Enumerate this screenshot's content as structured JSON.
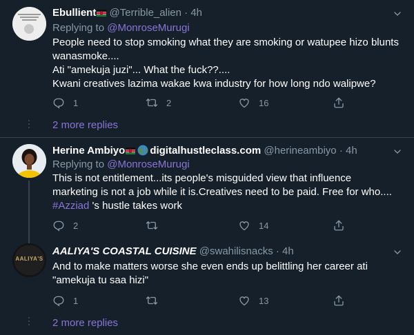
{
  "colors": {
    "background": "#15202b",
    "text": "#ffffff",
    "muted": "#8899a6",
    "accent": "#8a74d6",
    "border": "#38444d"
  },
  "tweets": [
    {
      "name": "Ebullient",
      "handle": "@Terrible_alien",
      "separator": "·",
      "time": "4h",
      "replying_label": "Replying to",
      "replying_to": "@MonroseMurugi",
      "lines": [
        "People need to stop smoking what they are smoking or watupee hizo blunts",
        "wanasmoke....",
        "Ati \"amekuja juzi\"... What the fuck??....",
        "Kwani creatives lazima wakae kwa industry for how long ndo walipwe?"
      ],
      "replies": "1",
      "retweets": "2",
      "likes": "16"
    },
    {
      "name": "Herine Ambiyo",
      "name_suffix": "digitalhustleclass.com",
      "handle": "@herineambiyo",
      "separator": "·",
      "time": "4h",
      "replying_label": "Replying to",
      "replying_to": "@MonroseMurugi",
      "lines": [
        "This is not entitlement...its people's misguided view that influence",
        "marketing is not a job while it is.Creatives need to be paid. Free for who...."
      ],
      "hashtag": "#Azziad",
      "hashtag_rest": " 's hustle takes work",
      "replies": "2",
      "retweets": "",
      "likes": "14"
    },
    {
      "name": "AALIYA'S COASTAL CUISINE",
      "avatar_text": "AALIYA'S",
      "handle": "@swahilisnacks",
      "separator": "·",
      "time": "4h",
      "lines": [
        "And to make matters worse she even ends up belittling her career ati",
        "\"amekuja tu saa hizi\""
      ],
      "replies": "1",
      "retweets": "",
      "likes": "13"
    }
  ],
  "more_replies_label": "2 more replies",
  "icons": [
    "chevron-down-icon",
    "reply-icon",
    "retweet-icon",
    "like-icon",
    "share-icon",
    "kenya-flag-icon",
    "globe-icon"
  ]
}
